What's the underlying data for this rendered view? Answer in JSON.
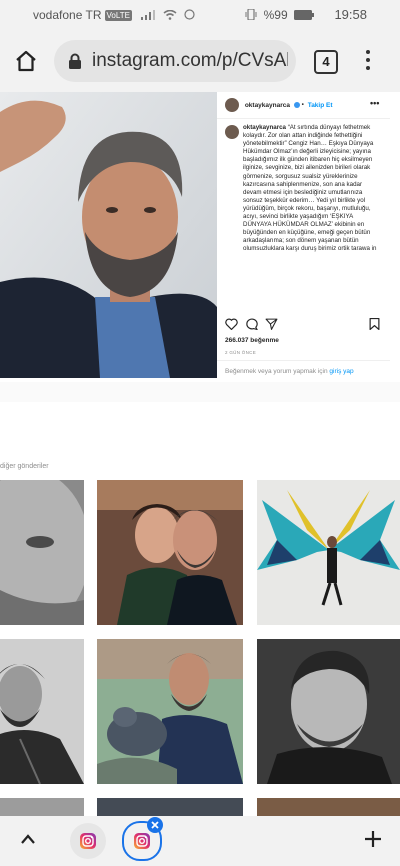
{
  "status_bar": {
    "carrier": "vodafone TR",
    "network_badge": "VoLTE",
    "battery": "%99",
    "time": "19:58"
  },
  "browser": {
    "url": "instagram.com/p/CVsAl",
    "tab_count": "4"
  },
  "post": {
    "username": "oktaykaynarca",
    "follow_label": "Takip Et",
    "caption_username": "oktaykaynarca",
    "caption_text": "“At sırtında dünyayı fethetmek kolaydır. Zor olan attan indiğinde fethettiğini yönetebilmektir” Cengiz Han… Eşkıya Dünyaya Hükümdar Olmaz’ın değerli izleyicisine; yayına başladığımız ilk günden itibaren hiç eksilmeyen ilginize, sevginize, bizi ailenizden birileri olarak görmenize, sorgusuz sualsiz yüreklerinize kazırcasına sahiplenmenize, son ana kadar devam etmesi için beslediğiniz umutlarınıza sonsuz teşekkür ederim… Yedi yıl birlikte yol yürüdüğüm, birçok rekoru, başarıyı, mutluluğu, acıyı, sevinci birlikte yaşadığım ‘EŞKIYA DÜNYAYA HÜKÜMDAR OLMAZ’ ekibinin en büyüğünden en küçüğüne, emeği geçen bütün arkadaşlarıma; son dönem yaşanan bütün olumsuzluklara karşı duruş birimiz ortik tarawa in",
    "likes": "266.037 beğenme",
    "date": "2 GÜN ÖNCE",
    "comment_prompt": "Beğenmek veya yorum yapmak için",
    "login_link": "giriş yap"
  },
  "more_posts_title": "diğer gönderiler",
  "icons": {
    "home": "home-icon",
    "lock": "lock-icon",
    "menu": "more-vert-icon",
    "heart": "heart-icon",
    "comment": "comment-icon",
    "share": "share-icon",
    "bookmark": "bookmark-icon",
    "up": "chevron-up-icon",
    "plus": "plus-icon",
    "close": "close-icon",
    "instagram": "instagram-icon"
  },
  "colors": {
    "instagram_blue": "#0095f6",
    "bar_bg": "#f2f2f2",
    "close_badge": "#1a73e8"
  }
}
